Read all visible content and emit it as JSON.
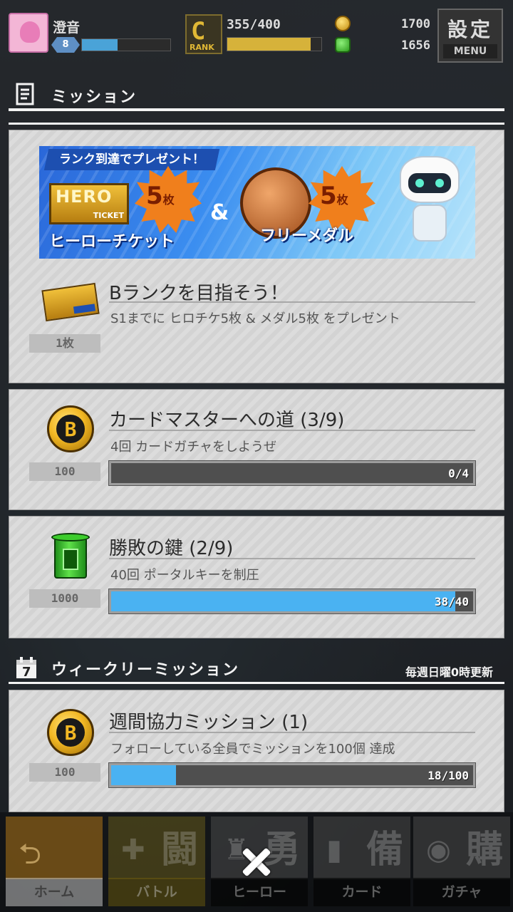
{
  "player": {
    "name": "澄音",
    "level_badge": "8",
    "exp_fill_percent": 40
  },
  "rank": {
    "letter": "C",
    "label": "RANK",
    "value": "355/400",
    "fill_percent": 88.75
  },
  "currencies": {
    "gold": "1700",
    "green": "1656"
  },
  "menu": {
    "kanji": "設定",
    "label": "MENU"
  },
  "mission_section": {
    "title": "ミッション"
  },
  "rank_mission": {
    "banner": {
      "ribbon": "ランク到達でプレゼント！",
      "hero_ticket_top": "HERO",
      "hero_ticket_bottom": "TICKET",
      "count1": "5",
      "unit1": "枚",
      "amp": "&",
      "count2": "5",
      "unit2": "枚",
      "caption1": "ヒーローチケット",
      "caption2": "フリーメダル"
    },
    "qty": "1枚",
    "title": "Bランクを目指そう！",
    "desc": "S1までに ヒロチケ5枚 & メダル5枚 をプレゼント"
  },
  "missions": [
    {
      "qty": "100",
      "title": "カードマスターへの道 (3/9)",
      "desc": "4回 カードガチャをしようぜ",
      "progress": "0/4",
      "fill_percent": 0
    },
    {
      "qty": "1000",
      "title": "勝敗の鍵 (2/9)",
      "desc": "40回 ポータルキーを制圧",
      "progress": "38/40",
      "fill_percent": 95
    }
  ],
  "weekly_section": {
    "title": "ウィークリーミッション",
    "reset_note": "毎週日曜0時更新",
    "calendar_day": "7"
  },
  "weekly_missions": [
    {
      "qty": "100",
      "title": "週間協力ミッション (1)",
      "desc": "フォローしている全員でミッションを100個 達成",
      "progress": "18/100",
      "fill_percent": 18
    }
  ],
  "nav": [
    {
      "label": "ホーム",
      "kanji": ""
    },
    {
      "label": "バトル",
      "kanji": "闘"
    },
    {
      "label": "ヒーロー",
      "kanji": "勇"
    },
    {
      "label": "カード",
      "kanji": "備"
    },
    {
      "label": "ガチャ",
      "kanji": "購"
    }
  ]
}
